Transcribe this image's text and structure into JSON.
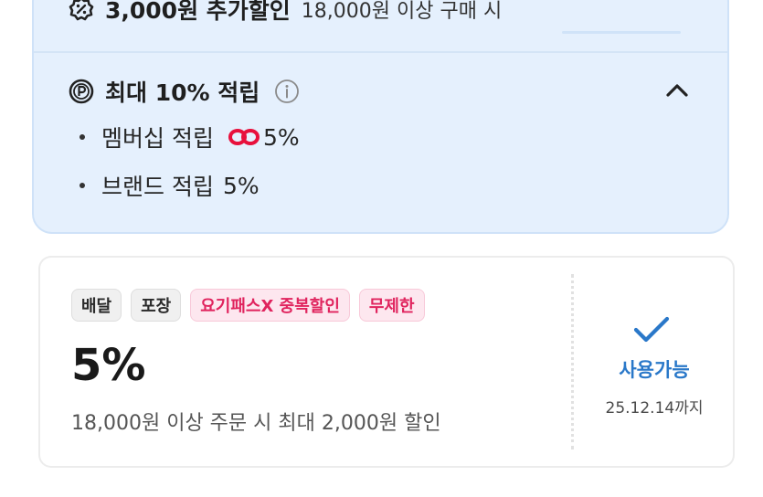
{
  "benefits": {
    "discount": {
      "title": "3,000원 추가할인",
      "condition": "18,000원 이상 구매 시",
      "icon": "percent-badge-icon"
    },
    "points": {
      "title": "최대 10% 적립",
      "icon": "point-coin-icon",
      "info_icon": "info-icon",
      "toggle_icon": "chevron-up-icon",
      "items": [
        {
          "label": "멤버십 적립",
          "brand_icon": "membership-logo-icon",
          "value": "5%"
        },
        {
          "label": "브랜드 적립",
          "value": "5%"
        }
      ]
    }
  },
  "coupon": {
    "tags": [
      "배달",
      "포장",
      "요기패스X 중복할인",
      "무제한"
    ],
    "percent": "5%",
    "description": "18,000원 이상 주문 시 최대 2,000원 할인",
    "status": "사용가능",
    "expiry": "25.12.14까지",
    "status_color": "#2a78c9"
  },
  "colors": {
    "panel_bg": "#e5f0fd",
    "pink_tag": "#e0245e",
    "membership_red": "#e8103c"
  }
}
